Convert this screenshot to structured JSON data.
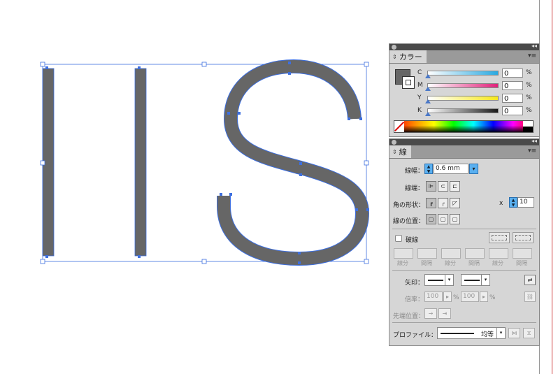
{
  "color_panel": {
    "tab_label": "カラー",
    "sliders": [
      {
        "channel": "C",
        "value": "0",
        "unit": "%",
        "gradient_to": "#29a9e1",
        "percent": 0
      },
      {
        "channel": "M",
        "value": "0",
        "unit": "%",
        "gradient_to": "#e0217a",
        "percent": 0
      },
      {
        "channel": "Y",
        "value": "0",
        "unit": "%",
        "gradient_to": "#f6e81a",
        "percent": 0
      },
      {
        "channel": "K",
        "value": "0",
        "unit": "%",
        "gradient_to": "#1a1a1a",
        "percent": 0
      }
    ]
  },
  "stroke_panel": {
    "tab_label": "線",
    "weight_label": "線幅：",
    "weight_value": "0.6 mm",
    "cap_label": "線端：",
    "corner_label": "角の形状：",
    "miter_x": "x",
    "miter_value": "10",
    "align_label": "線の位置：",
    "dashed_label": "破線",
    "dash_labels": [
      "線分",
      "間隔",
      "線分",
      "間隔",
      "線分",
      "間隔"
    ],
    "arrow_label": "矢印：",
    "scale_label": "倍率：",
    "scale_start": "100",
    "scale_end": "100",
    "percent": "%",
    "tip_label": "先端位置：",
    "profile_label": "プロファイル：",
    "profile_value": "均等"
  },
  "artwork": {
    "fill_color": "#666666",
    "path_color": "#3d6fe0"
  }
}
